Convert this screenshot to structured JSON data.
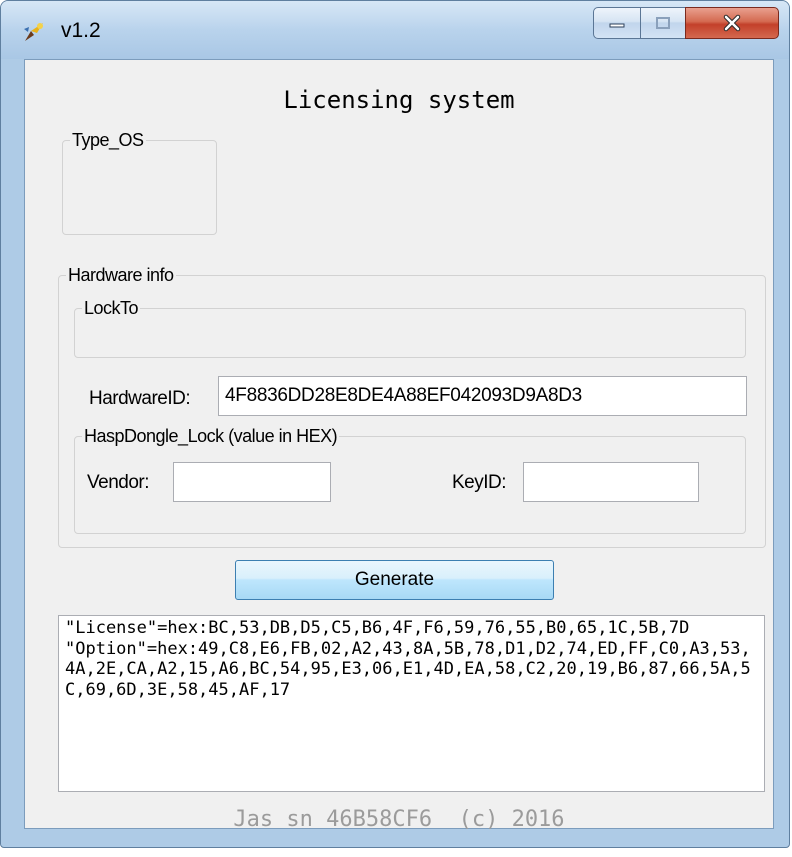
{
  "window": {
    "title": "v1.2",
    "controls": {
      "minimize": "minimize",
      "maximize": "maximize",
      "close": "close"
    }
  },
  "form": {
    "heading": "Licensing system",
    "type_os": {
      "label": "Type_OS"
    },
    "hardware_info": {
      "label": "Hardware info",
      "lock_to": {
        "label": "LockTo"
      },
      "hardware_id": {
        "label": "HardwareID:",
        "value": "4F8836DD28E8DE4A88EF042093D9A8D3"
      },
      "hasp": {
        "label": "HaspDongle_Lock (value in HEX)",
        "vendor": {
          "label": "Vendor:",
          "value": ""
        },
        "key_id": {
          "label": "KeyID:",
          "value": ""
        }
      }
    },
    "generate_label": "Generate",
    "output": "\"License\"=hex:BC,53,DB,D5,C5,B6,4F,F6,59,76,55,B0,65,1C,5B,7D\n\"Option\"=hex:49,C8,E6,FB,02,A2,43,8A,5B,78,D1,D2,74,ED,FF,C0,A3,53,4A,2E,CA,A2,15,A6,BC,54,95,E3,06,E1,4D,EA,58,C2,20,19,B6,87,66,5A,5C,69,6D,3E,58,45,AF,17",
    "footer": "Jas sn 46B58CF6  (c) 2016"
  }
}
